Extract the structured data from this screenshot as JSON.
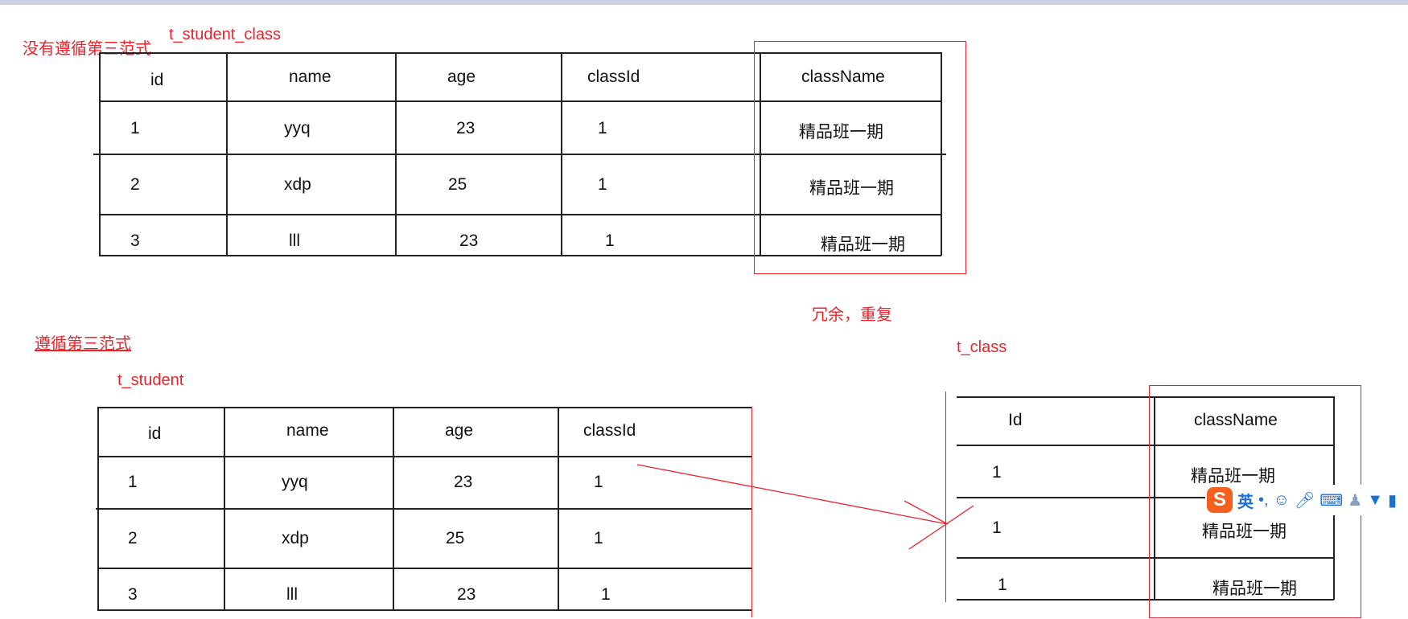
{
  "annotations": {
    "no_3nf": "没有遵循第三范式",
    "table1_name": "t_student_class",
    "redundant": "冗余，重复",
    "follow_3nf": "遵循第三范式",
    "table2_name": "t_student",
    "table3_name": "t_class"
  },
  "student_class_table": {
    "headers": [
      "id",
      "name",
      "age",
      "classId",
      "className"
    ],
    "rows": [
      [
        "1",
        "yyq",
        "23",
        "1",
        "精品班一期"
      ],
      [
        "2",
        "xdp",
        "25",
        "1",
        "精品班一期"
      ],
      [
        "3",
        "lll",
        "23",
        "1",
        "精品班一期"
      ]
    ]
  },
  "student_table": {
    "headers": [
      "id",
      "name",
      "age",
      "classId"
    ],
    "rows": [
      [
        "1",
        "yyq",
        "23",
        "1"
      ],
      [
        "2",
        "xdp",
        "25",
        "1"
      ],
      [
        "3",
        "lll",
        "23",
        "1"
      ]
    ]
  },
  "class_table": {
    "headers": [
      "Id",
      "className"
    ],
    "rows": [
      [
        "1",
        "精品班一期"
      ],
      [
        "1",
        "精品班一期"
      ],
      [
        "1",
        "精品班一期"
      ]
    ]
  },
  "ime_toolbar": {
    "logo": "S",
    "lang": "英",
    "icons": [
      "punctuation-icon",
      "emoji-icon",
      "microphone-icon",
      "keyboard-icon",
      "user-icon",
      "skin-icon",
      "toolbox-icon"
    ]
  },
  "colors": {
    "annotation_red": "#e8242c",
    "ime_blue": "#1a6fd6",
    "ime_logo": "#f5601e"
  }
}
